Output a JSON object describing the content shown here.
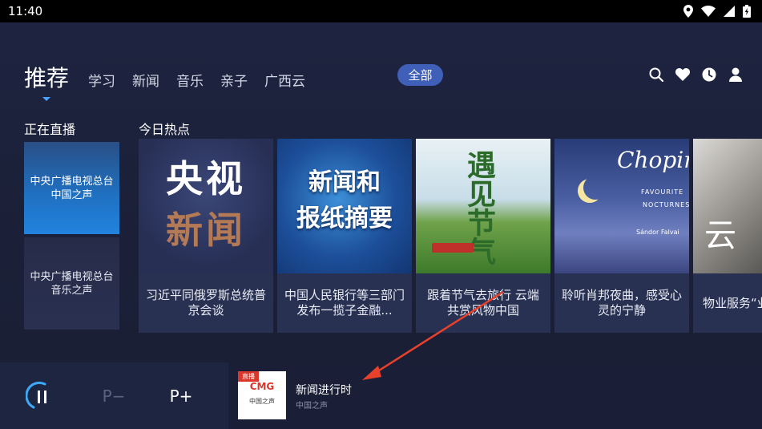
{
  "status_bar": {
    "time": "11:40",
    "icons": [
      "location-icon",
      "wifi-icon",
      "signal-icon",
      "battery-charging-icon"
    ]
  },
  "nav": {
    "tabs": [
      {
        "label": "推荐",
        "active": true
      },
      {
        "label": "学习"
      },
      {
        "label": "新闻"
      },
      {
        "label": "音乐"
      },
      {
        "label": "亲子"
      },
      {
        "label": "广西云"
      }
    ],
    "all_button": "全部",
    "icons": [
      "search-icon",
      "heart-icon",
      "history-clock-icon",
      "user-icon"
    ]
  },
  "live": {
    "title": "正在直播",
    "items": [
      {
        "label": "中央广播电视总台中国之声",
        "selected": true
      },
      {
        "label": "中央广播电视总台音乐之声"
      }
    ]
  },
  "hot": {
    "title": "今日热点",
    "cards": [
      {
        "thumb_text": [
          "央视",
          "新闻"
        ],
        "caption": "习近平同俄罗斯总统普京会谈"
      },
      {
        "thumb_text": [
          "新闻和",
          "报纸摘要"
        ],
        "caption": "中国人民银行等三部门发布一揽子金融..."
      },
      {
        "thumb_text": [
          "遇见节气"
        ],
        "caption": "跟着节气去旅行 云端共赏风物中国"
      },
      {
        "thumb_text": [
          "Chopin",
          "FAVOURITE",
          "NOCTURNES",
          "Sándor Falvai"
        ],
        "caption": "聆听肖邦夜曲，感受心灵的宁静"
      },
      {
        "thumb_text": [
          "云"
        ],
        "caption": "物业服务“业主该怎"
      }
    ]
  },
  "player": {
    "pause_icon": "pause-icon",
    "prev_label": "P−",
    "next_label": "P+",
    "now_playing": {
      "cover_badge": "直播",
      "cover_logo": "CMG",
      "cover_text": "中国之声",
      "title": "新闻进行时",
      "subtitle": "中国之声"
    }
  },
  "colors": {
    "accent": "#3f5fb8",
    "selected_live": "#2283de",
    "background": "#1c2138",
    "annotation_arrow": "#e8412b"
  }
}
